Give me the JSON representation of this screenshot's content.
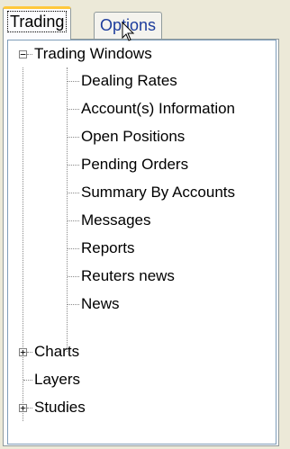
{
  "tabs": [
    {
      "label": "Trading",
      "active": true
    },
    {
      "label": "Options",
      "active": false
    }
  ],
  "tree": {
    "root": {
      "label": "Trading Windows",
      "expanded": true,
      "children": [
        "Dealing Rates",
        "Account(s) Information",
        "Open Positions",
        "Pending Orders",
        "Summary By Accounts",
        "Messages",
        "Reports",
        "Reuters news",
        "News"
      ]
    },
    "charts": {
      "label": "Charts",
      "expanded": false
    },
    "layers": {
      "label": "Layers"
    },
    "studies": {
      "label": "Studies",
      "expanded": false
    }
  },
  "icons": {
    "collapse": "minus",
    "expand": "plus",
    "cursor": "arrow-pointer-icon"
  },
  "colors": {
    "active_tab_accent": "#ffc83c",
    "window_bg": "#ece9d8",
    "tree_border": "#7f9db9"
  }
}
